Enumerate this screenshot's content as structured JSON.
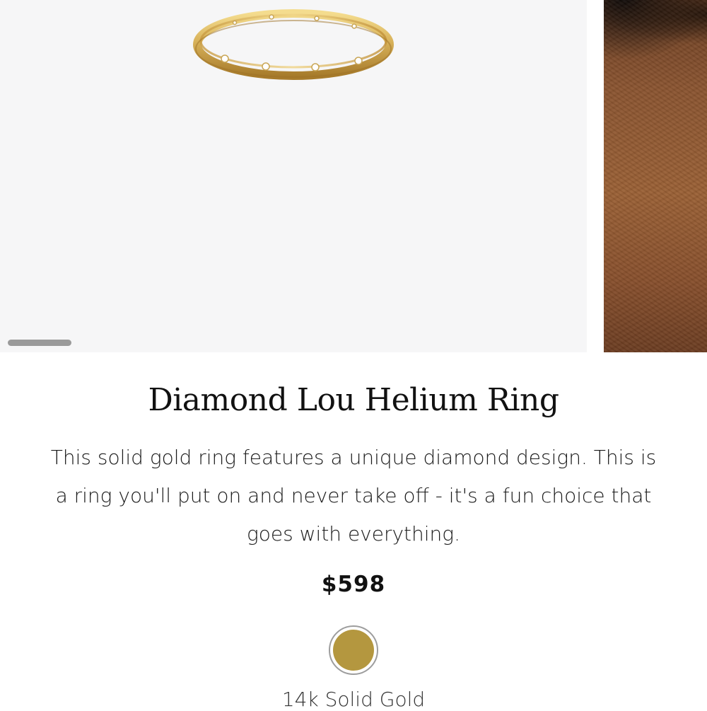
{
  "product": {
    "title": "Diamond Lou Helium Ring",
    "description": "This solid gold ring features a unique diamond design. This is a ring you'll put on and never take off - it's a fun choice that goes with everything.",
    "price": "$598"
  },
  "gallery": {
    "main_image_icon": "gold-ring-image",
    "next_image_icon": "model-skin-image"
  },
  "variant": {
    "selected_label": "14k Solid Gold",
    "swatch_color": "#b4973f"
  }
}
